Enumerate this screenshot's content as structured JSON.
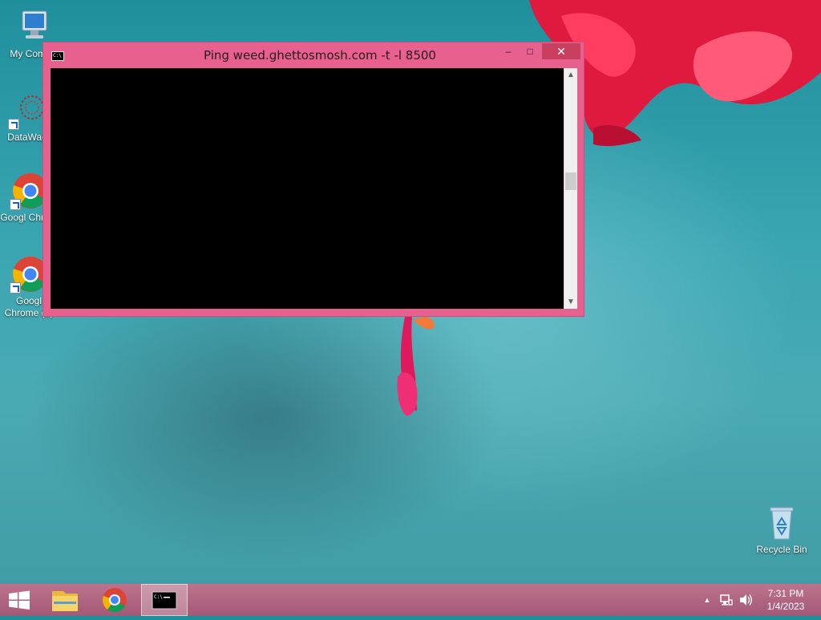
{
  "desktop": {
    "icons": [
      {
        "label": "My Comp",
        "icon": "computer-icon"
      },
      {
        "label": "DataWag",
        "icon": "datawag-icon"
      },
      {
        "label": "Googl Chrom",
        "icon": "chrome-icon"
      },
      {
        "label": "Googl Chrome (2)",
        "icon": "chrome-icon"
      },
      {
        "label": "Recycle Bin",
        "icon": "recycle-bin-icon"
      }
    ]
  },
  "window": {
    "title": "Ping  weed.ghettosmosh.com -t -l 8500",
    "icon": "console-icon",
    "controls": {
      "minimize": "–",
      "maximize": "□",
      "close": "✕"
    }
  },
  "taskbar": {
    "start_icon": "windows-logo-icon",
    "pinned": [
      "file-explorer-icon",
      "chrome-icon",
      "command-prompt-icon"
    ],
    "active": "command-prompt-icon",
    "tray_arrow": "▲",
    "clock": {
      "time": "7:31 PM",
      "date": "1/4/2023"
    }
  },
  "colors": {
    "window_frame": "#e8608e",
    "close_button": "#c9405e",
    "console_bg": "#000000",
    "taskbar": "#b8637f"
  }
}
